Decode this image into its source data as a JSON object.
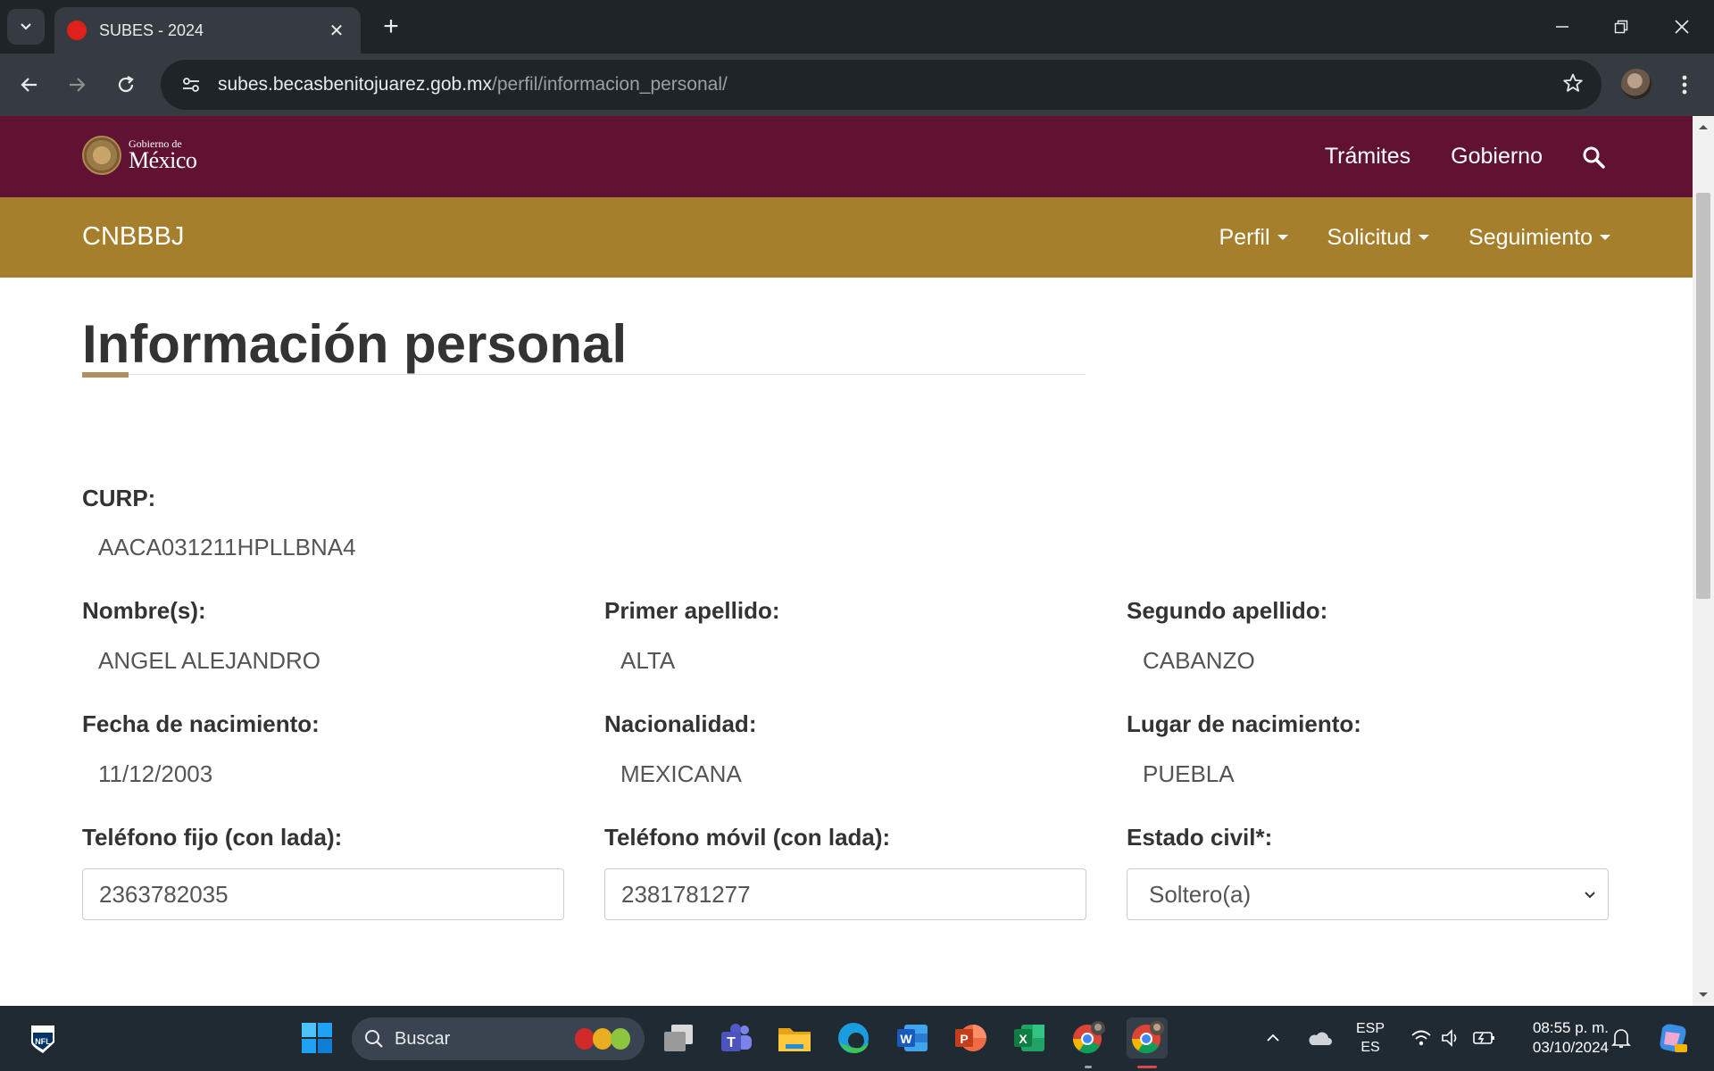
{
  "browser": {
    "tab_title": "SUBES - 2024",
    "url_host": "subes.becasbenitojuarez.gob.mx",
    "url_path": "/perfil/informacion_personal/"
  },
  "gob_header": {
    "logo_small": "Gobierno de",
    "logo_big": "México",
    "nav": [
      "Trámites",
      "Gobierno"
    ]
  },
  "sub_header": {
    "brand": "CNBBBJ",
    "menu": [
      "Perfil",
      "Solicitud",
      "Seguimiento"
    ]
  },
  "page": {
    "title": "Información personal",
    "curp": {
      "label": "CURP:",
      "value": "AACA031211HPLLBNA4"
    },
    "nombre": {
      "label": "Nombre(s):",
      "value": "ANGEL ALEJANDRO"
    },
    "primer_apellido": {
      "label": "Primer apellido:",
      "value": "ALTA"
    },
    "segundo_apellido": {
      "label": "Segundo apellido:",
      "value": "CABANZO"
    },
    "fecha_nacimiento": {
      "label": "Fecha de nacimiento:",
      "value": "11/12/2003"
    },
    "nacionalidad": {
      "label": "Nacionalidad:",
      "value": "MEXICANA"
    },
    "lugar_nacimiento": {
      "label": "Lugar de nacimiento:",
      "value": "PUEBLA"
    },
    "telefono_fijo": {
      "label": "Teléfono fijo (con lada):",
      "value": "2363782035"
    },
    "telefono_movil": {
      "label": "Teléfono móvil (con lada):",
      "value": "2381781277"
    },
    "estado_civil": {
      "label": "Estado civil*:",
      "value": "Soltero(a)"
    }
  },
  "taskbar": {
    "search_placeholder": "Buscar",
    "lang_top": "ESP",
    "lang_bottom": "ES",
    "time": "08:55 p. m.",
    "date": "03/10/2024"
  },
  "colors": {
    "gob_guinda": "#611232",
    "gob_dorado": "#a57f2c",
    "title_accent": "#b38e5d"
  }
}
